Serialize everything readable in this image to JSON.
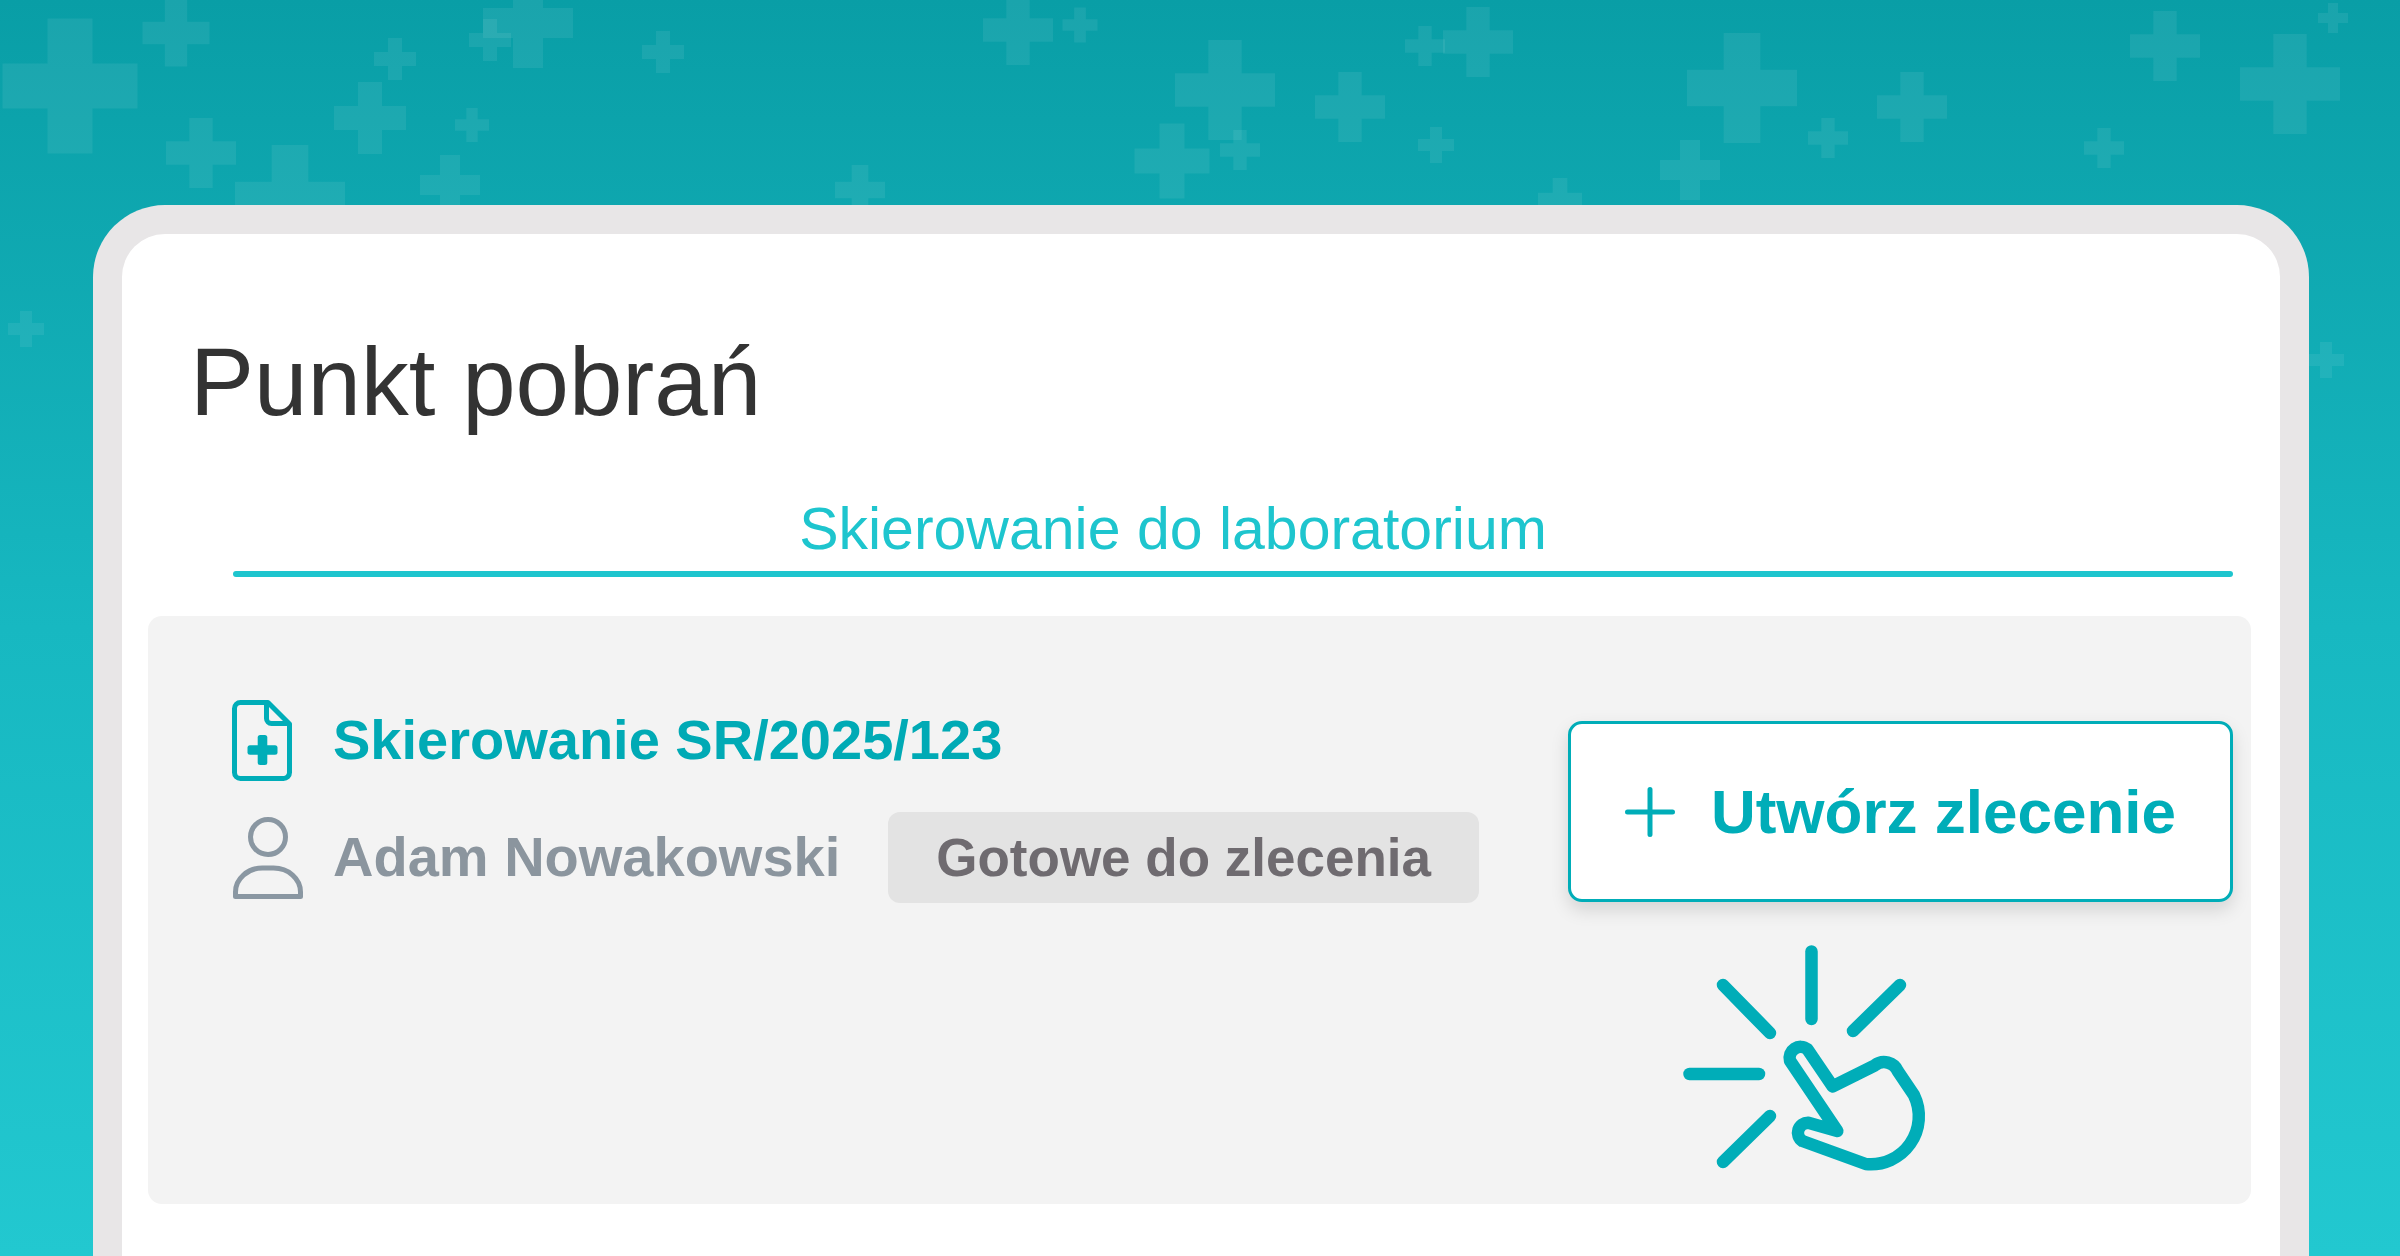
{
  "title": "Punkt pobrań",
  "tabs": [
    {
      "label": "Skierowanie do laboratorium",
      "selected": true
    }
  ],
  "referral": {
    "number": "Skierowanie SR/2025/123",
    "patient": "Adam Nowakowski",
    "status": "Gotowe do zlecenia"
  },
  "action_button": {
    "label": "Utwórz zlecenie"
  }
}
